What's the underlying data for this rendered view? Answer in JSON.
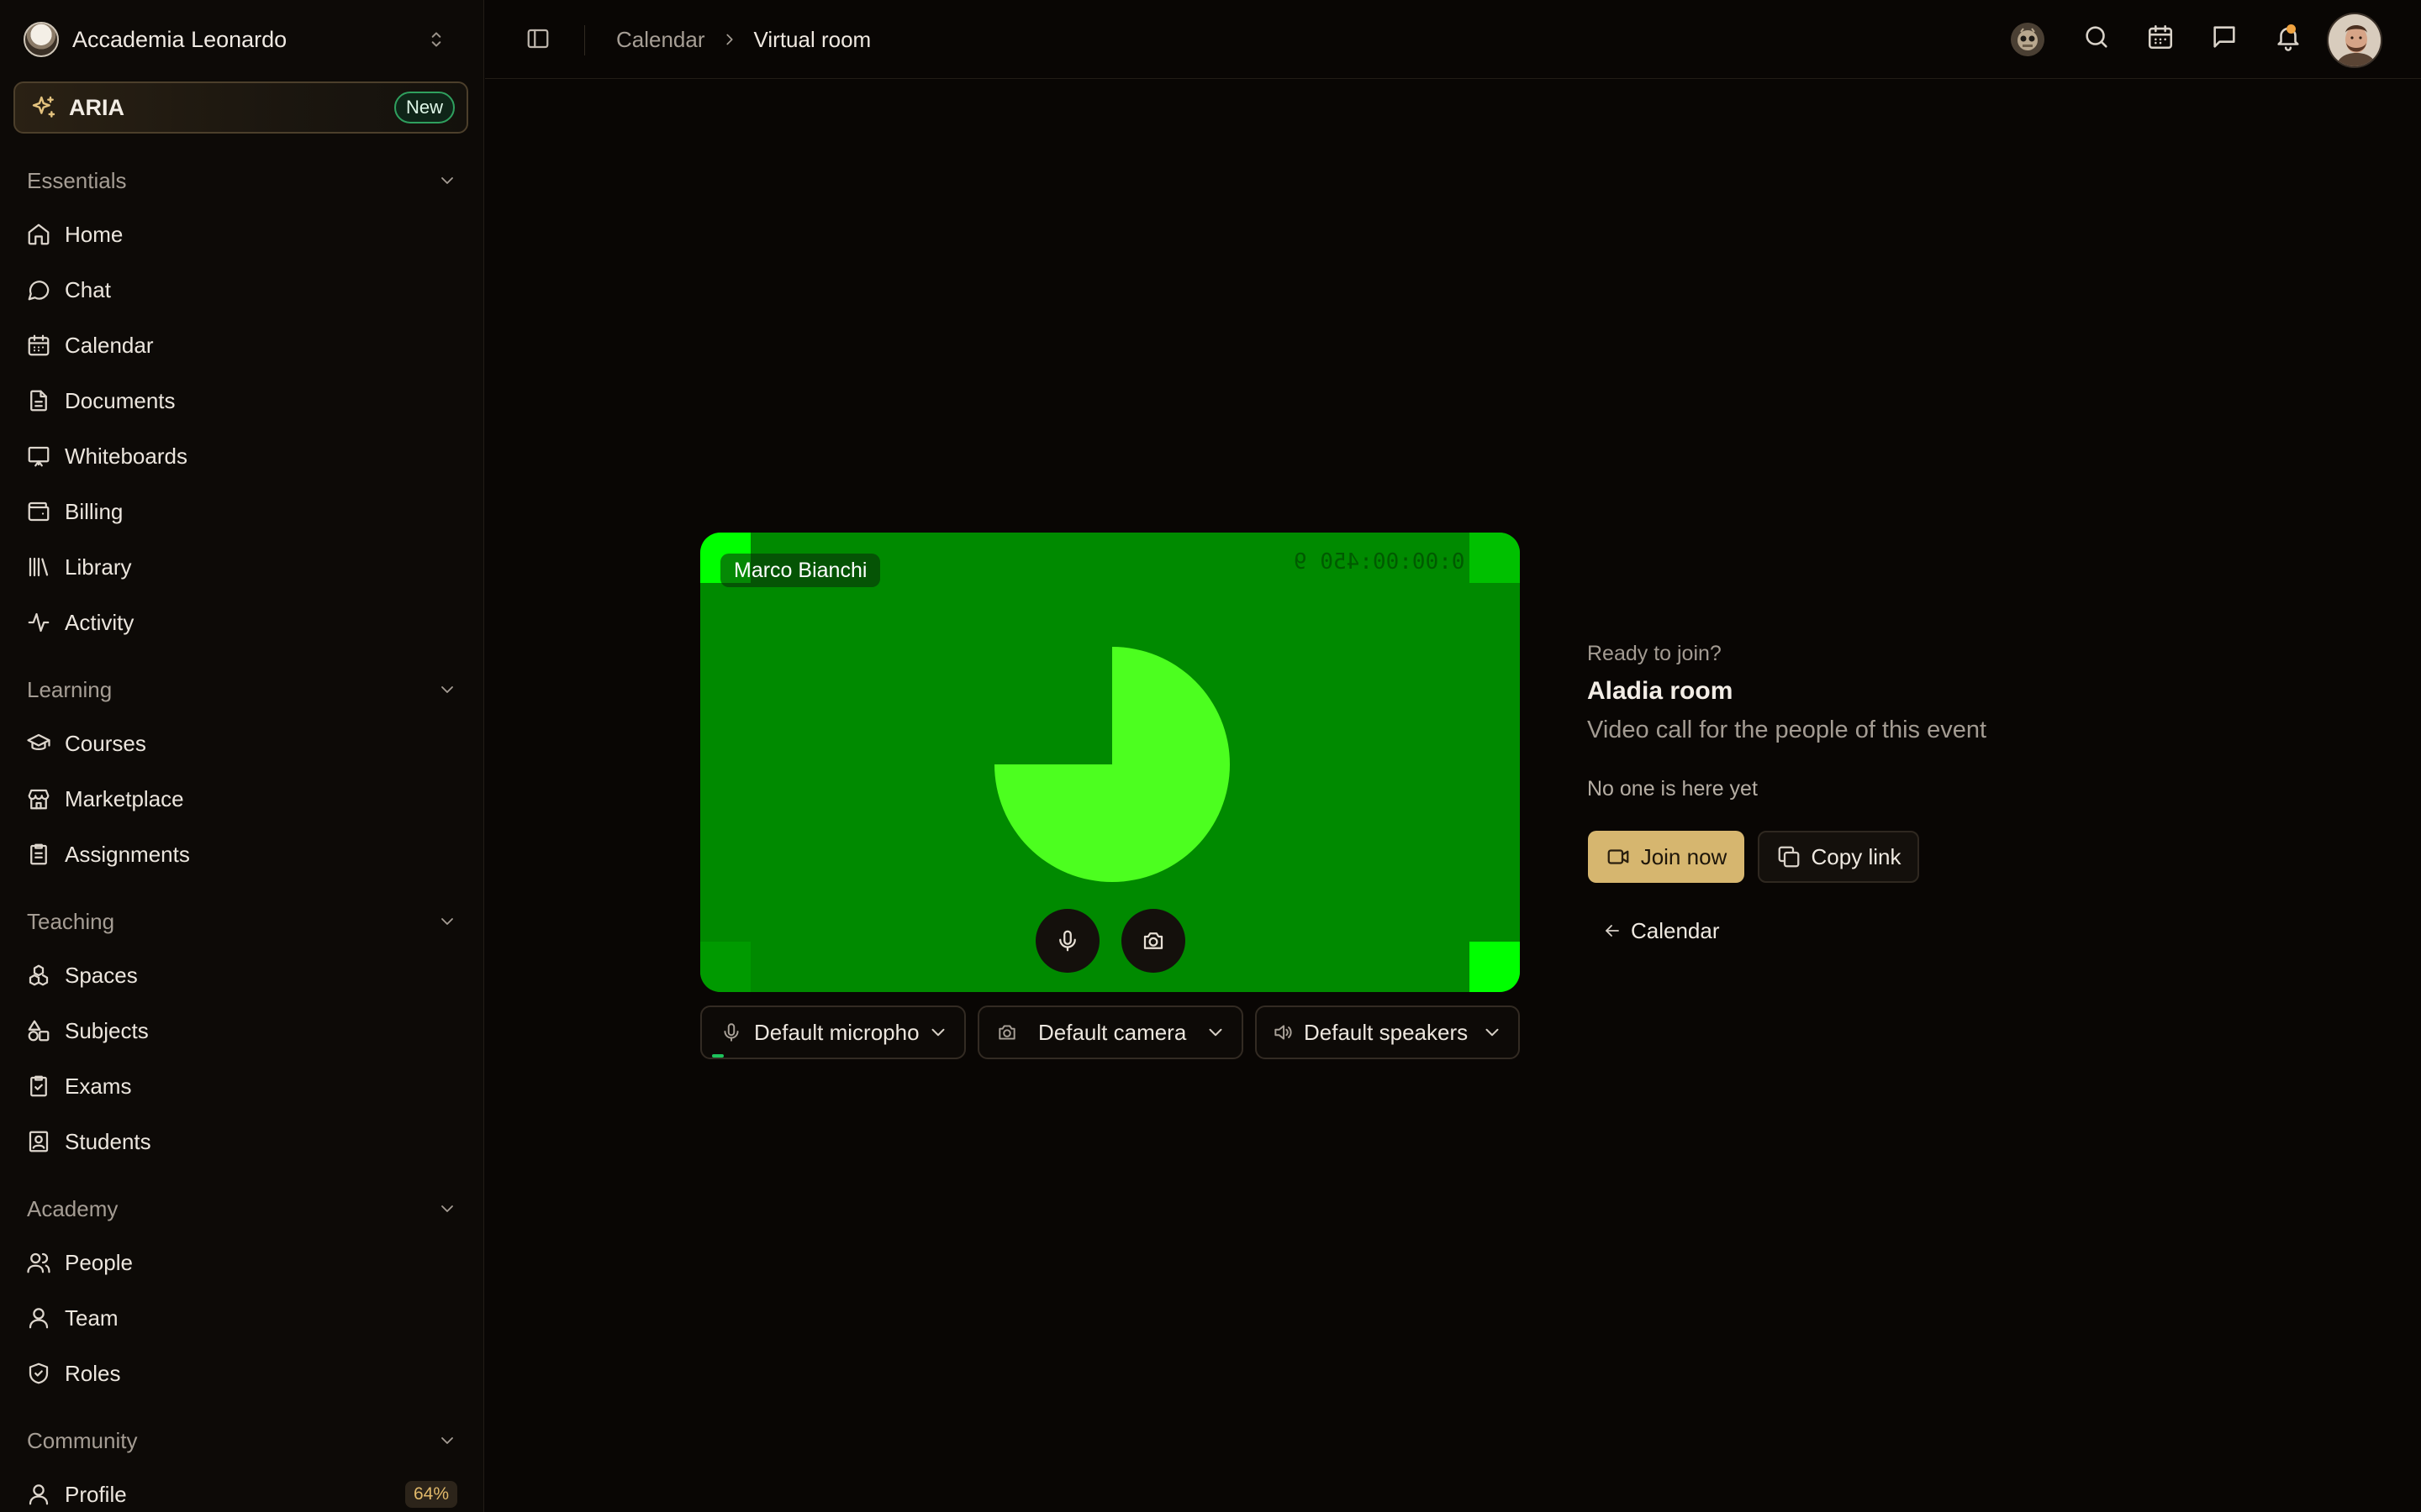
{
  "org": {
    "name": "Accademia Leonardo"
  },
  "aria": {
    "label": "ARIA",
    "badge": "New"
  },
  "sections": {
    "essentials": "Essentials",
    "learning": "Learning",
    "teaching": "Teaching",
    "academy": "Academy",
    "community": "Community"
  },
  "nav": {
    "home": "Home",
    "chat": "Chat",
    "calendar": "Calendar",
    "documents": "Documents",
    "whiteboards": "Whiteboards",
    "billing": "Billing",
    "library": "Library",
    "activity": "Activity",
    "courses": "Courses",
    "marketplace": "Marketplace",
    "assignments": "Assignments",
    "spaces": "Spaces",
    "subjects": "Subjects",
    "exams": "Exams",
    "students": "Students",
    "people": "People",
    "team": "Team",
    "roles": "Roles",
    "profile": "Profile",
    "profile_badge": "64%"
  },
  "breadcrumb": {
    "parent": "Calendar",
    "current": "Virtual room"
  },
  "preview": {
    "participant": "Marco Bianchi",
    "timecode": "0:00:00:450 9",
    "colors": {
      "background": "#008a00",
      "pie": "#4cff1f",
      "corner_bright": "#00ff00"
    }
  },
  "devices": {
    "microphone": "Default micropho",
    "camera": "Default camera",
    "speakers": "Default speakers"
  },
  "join_panel": {
    "ready": "Ready to join?",
    "room_name": "Aladia room",
    "description": "Video call for the people of this event",
    "presence": "No one is here yet",
    "join_label": "Join now",
    "copy_label": "Copy link",
    "back_label": "Calendar"
  },
  "theme": {
    "accent": "#d6b66f",
    "badge_green": "#2fa05e"
  }
}
